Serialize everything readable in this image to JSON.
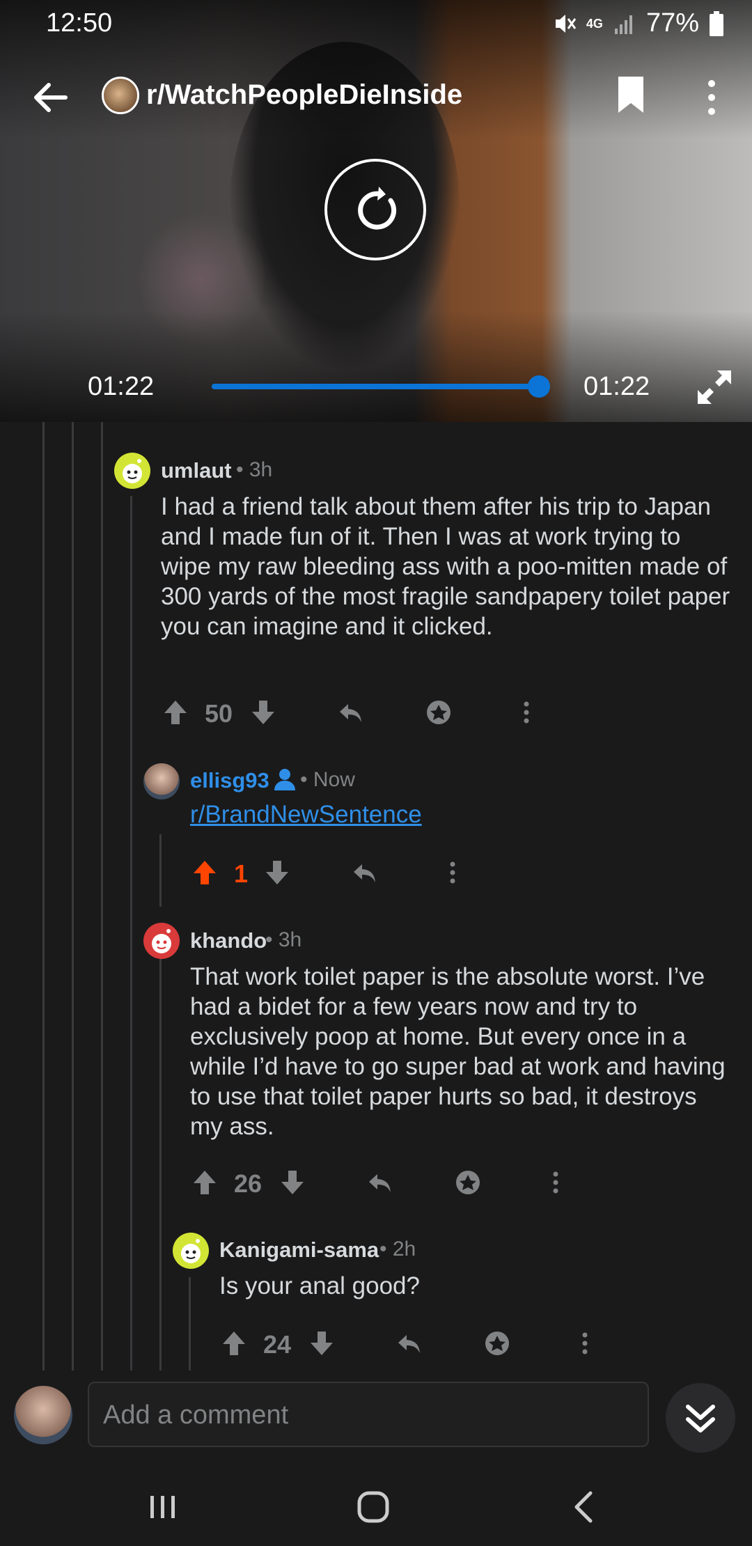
{
  "status_bar": {
    "time": "12:50",
    "network": "4G",
    "battery": "77%"
  },
  "header": {
    "subreddit": "r/WatchPeopleDieInside",
    "icons": [
      "back-arrow-icon",
      "bookmark-icon",
      "more-vertical-icon"
    ]
  },
  "video": {
    "current_time": "01:22",
    "total_time": "01:22",
    "progress": 1.0,
    "icons": [
      "replay-icon",
      "fullscreen-icon"
    ]
  },
  "comments": [
    {
      "user": "umlaut",
      "time": "3h",
      "body": "I had a friend talk about them after his trip to Japan and I made fun of it. Then I was at work trying to wipe my raw bleeding ass with a poo-mitten made of 300 yards of the most fragile sandpapery toilet paper you can imagine and it clicked.",
      "score": "50"
    },
    {
      "user": "ellisg93",
      "time": "Now",
      "link": "r/BrandNewSentence",
      "score": "1",
      "upvoted": true
    },
    {
      "user": "khando",
      "time": "3h",
      "body": "That work toilet paper is the absolute worst. I’ve had a bidet for a few years now and try to exclusively poop at home. But every once in a while I’d have to go super bad at work and having to use that toilet paper hurts so bad, it destroys my ass.",
      "score": "26"
    },
    {
      "user": "Kanigami-sama",
      "time": "2h",
      "body": "Is your anal good?",
      "score": "24"
    }
  ],
  "composer": {
    "placeholder": "Add a comment"
  },
  "colors": {
    "background": "#1a1a1b",
    "text": "#d7dadc",
    "meta": "#818384",
    "accent_blue": "#2f8fe8",
    "upvote_orange": "#ff4500",
    "seek_blue": "#0b74d6"
  }
}
